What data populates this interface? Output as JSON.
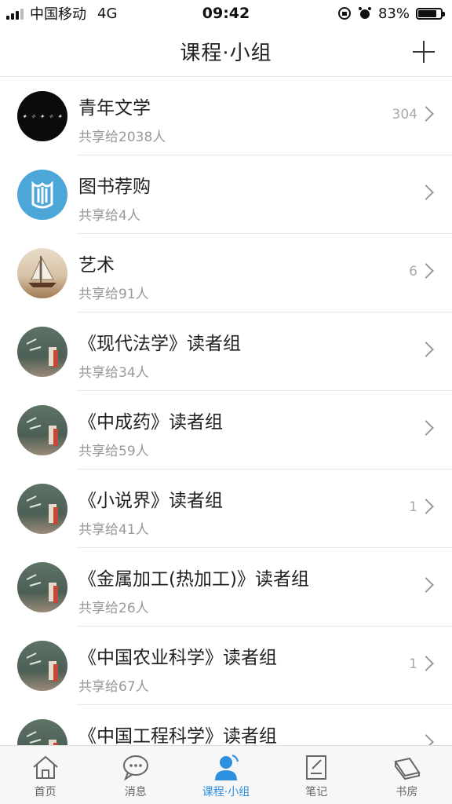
{
  "status_bar": {
    "carrier": "中国移动",
    "network": "4G",
    "time": "09:42",
    "battery_percent": "83%",
    "battery_level": 0.83
  },
  "nav": {
    "title": "课程·小组",
    "add_icon": "plus-icon"
  },
  "groups": [
    {
      "title": "青年文学",
      "subtitle": "共享给2038人",
      "count": "304",
      "avatar_text": "青年文学"
    },
    {
      "title": "图书荐购",
      "subtitle": "共享给4人",
      "count": ""
    },
    {
      "title": "艺术",
      "subtitle": "共享给91人",
      "count": "6"
    },
    {
      "title": "《现代法学》读者组",
      "subtitle": "共享给34人",
      "count": ""
    },
    {
      "title": "《中成药》读者组",
      "subtitle": "共享给59人",
      "count": ""
    },
    {
      "title": "《小说界》读者组",
      "subtitle": "共享给41人",
      "count": "1"
    },
    {
      "title": "《金属加工(热加工)》读者组",
      "subtitle": "共享给26人",
      "count": ""
    },
    {
      "title": "《中国农业科学》读者组",
      "subtitle": "共享给67人",
      "count": "1"
    },
    {
      "title": "《中国工程科学》读者组",
      "subtitle": "",
      "count": ""
    }
  ],
  "tabs": [
    {
      "label": "首页",
      "icon": "home-icon"
    },
    {
      "label": "消息",
      "icon": "chat-bubble-icon"
    },
    {
      "label": "课程·小组",
      "icon": "person-icon"
    },
    {
      "label": "笔记",
      "icon": "note-icon"
    },
    {
      "label": "书房",
      "icon": "book-icon"
    }
  ],
  "colors": {
    "accent": "#2c8fe0",
    "divider": "#e6e6e6",
    "subtitle": "#999999"
  }
}
